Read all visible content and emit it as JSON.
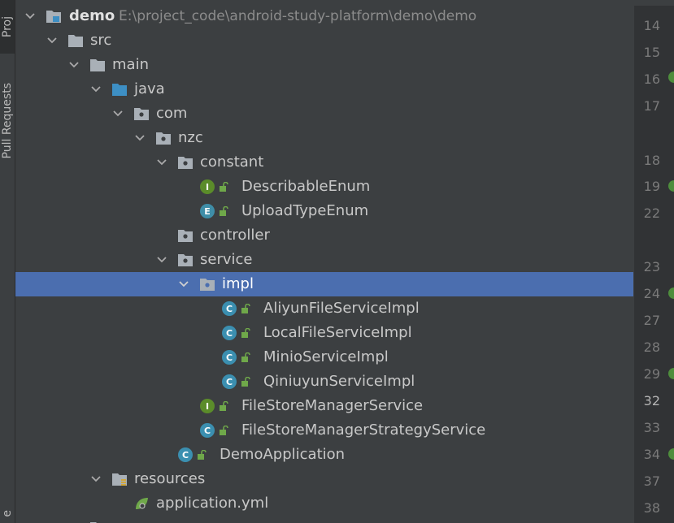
{
  "side_tabs": {
    "project": "Proj",
    "pull_requests": "Pull Requests",
    "bottom": "e"
  },
  "tree": {
    "root": {
      "name": "demo",
      "path": "E:\\project_code\\android-study-platform\\demo\\demo"
    },
    "src": "src",
    "main": "main",
    "java": "java",
    "com": "com",
    "nzc": "nzc",
    "constant": "constant",
    "describable_enum": "DescribableEnum",
    "upload_type_enum": "UploadTypeEnum",
    "controller": "controller",
    "service": "service",
    "impl": "impl",
    "aliyun": "AliyunFileServiceImpl",
    "local": "LocalFileServiceImpl",
    "minio": "MinioServiceImpl",
    "qiniuyun": "QiniuyunServiceImpl",
    "fsm_service": "FileStoreManagerService",
    "fsm_strategy": "FileStoreManagerStrategyService",
    "demo_app": "DemoApplication",
    "resources": "resources",
    "app_yml": "application.yml"
  },
  "badges": {
    "interface": "I",
    "enum": "E",
    "class": "C"
  },
  "gutter": {
    "lines": [
      "14",
      "15",
      "16",
      "17",
      "18",
      "19",
      "22",
      "23",
      "24",
      "27",
      "28",
      "29",
      "32",
      "33",
      "34",
      "37",
      "38"
    ],
    "current_line": "32"
  },
  "colors": {
    "selection": "#4b6eaf",
    "folder": "#a9b0b7",
    "source_folder": "#3d8fc4",
    "interface_badge": "#5b8c2a",
    "class_badge": "#3b8fb0"
  }
}
